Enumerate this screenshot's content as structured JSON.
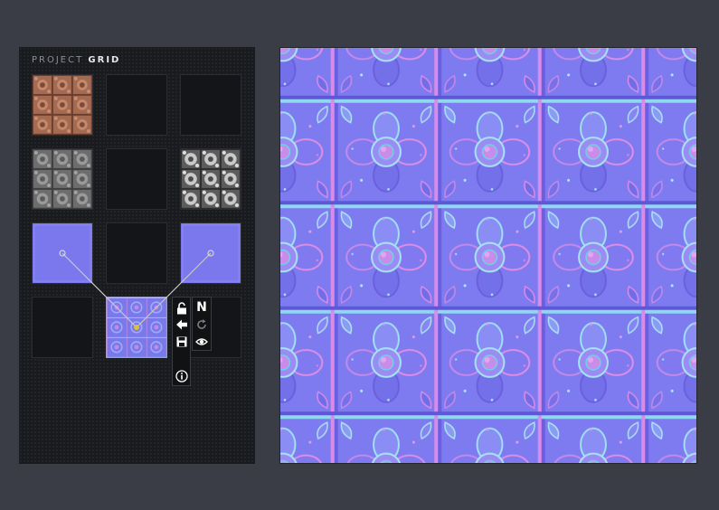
{
  "panel": {
    "title_prefix": "PROJECT",
    "title_highlight": "GRID"
  },
  "slots": [
    {
      "id": "diffuse",
      "state": "filled",
      "texture": "diffuse-tile-icon"
    },
    {
      "id": "empty-1",
      "state": "empty"
    },
    {
      "id": "empty-2",
      "state": "empty"
    },
    {
      "id": "height",
      "state": "filled",
      "texture": "height-tile-icon"
    },
    {
      "id": "empty-3",
      "state": "empty"
    },
    {
      "id": "specular",
      "state": "filled",
      "texture": "specular-tile-icon"
    },
    {
      "id": "normal-source-a",
      "state": "filled",
      "texture": "normal-tile-icon"
    },
    {
      "id": "empty-4",
      "state": "empty"
    },
    {
      "id": "normal-source-b",
      "state": "filled",
      "texture": "normal-tile-icon"
    },
    {
      "id": "empty-5",
      "state": "empty"
    },
    {
      "id": "normal-output",
      "state": "selected",
      "texture": "normal-tile-icon"
    },
    {
      "id": "empty-6",
      "state": "empty"
    }
  ],
  "toolbar_left": [
    "unlock-icon",
    "arrow-left-icon",
    "save-icon",
    "info-icon"
  ],
  "toolbar_right": {
    "normal_label": "N",
    "icons": [
      "normal-map-icon",
      "refresh-icon",
      "eye-icon"
    ]
  },
  "colors": {
    "background": "#3a3d46",
    "panel": "#1a1b1f",
    "normal_base": "#7f7cf0",
    "connector": "#c9c9c9",
    "node_dot": "#d8c23a"
  },
  "preview": {
    "texture": "normal-map-preview"
  }
}
